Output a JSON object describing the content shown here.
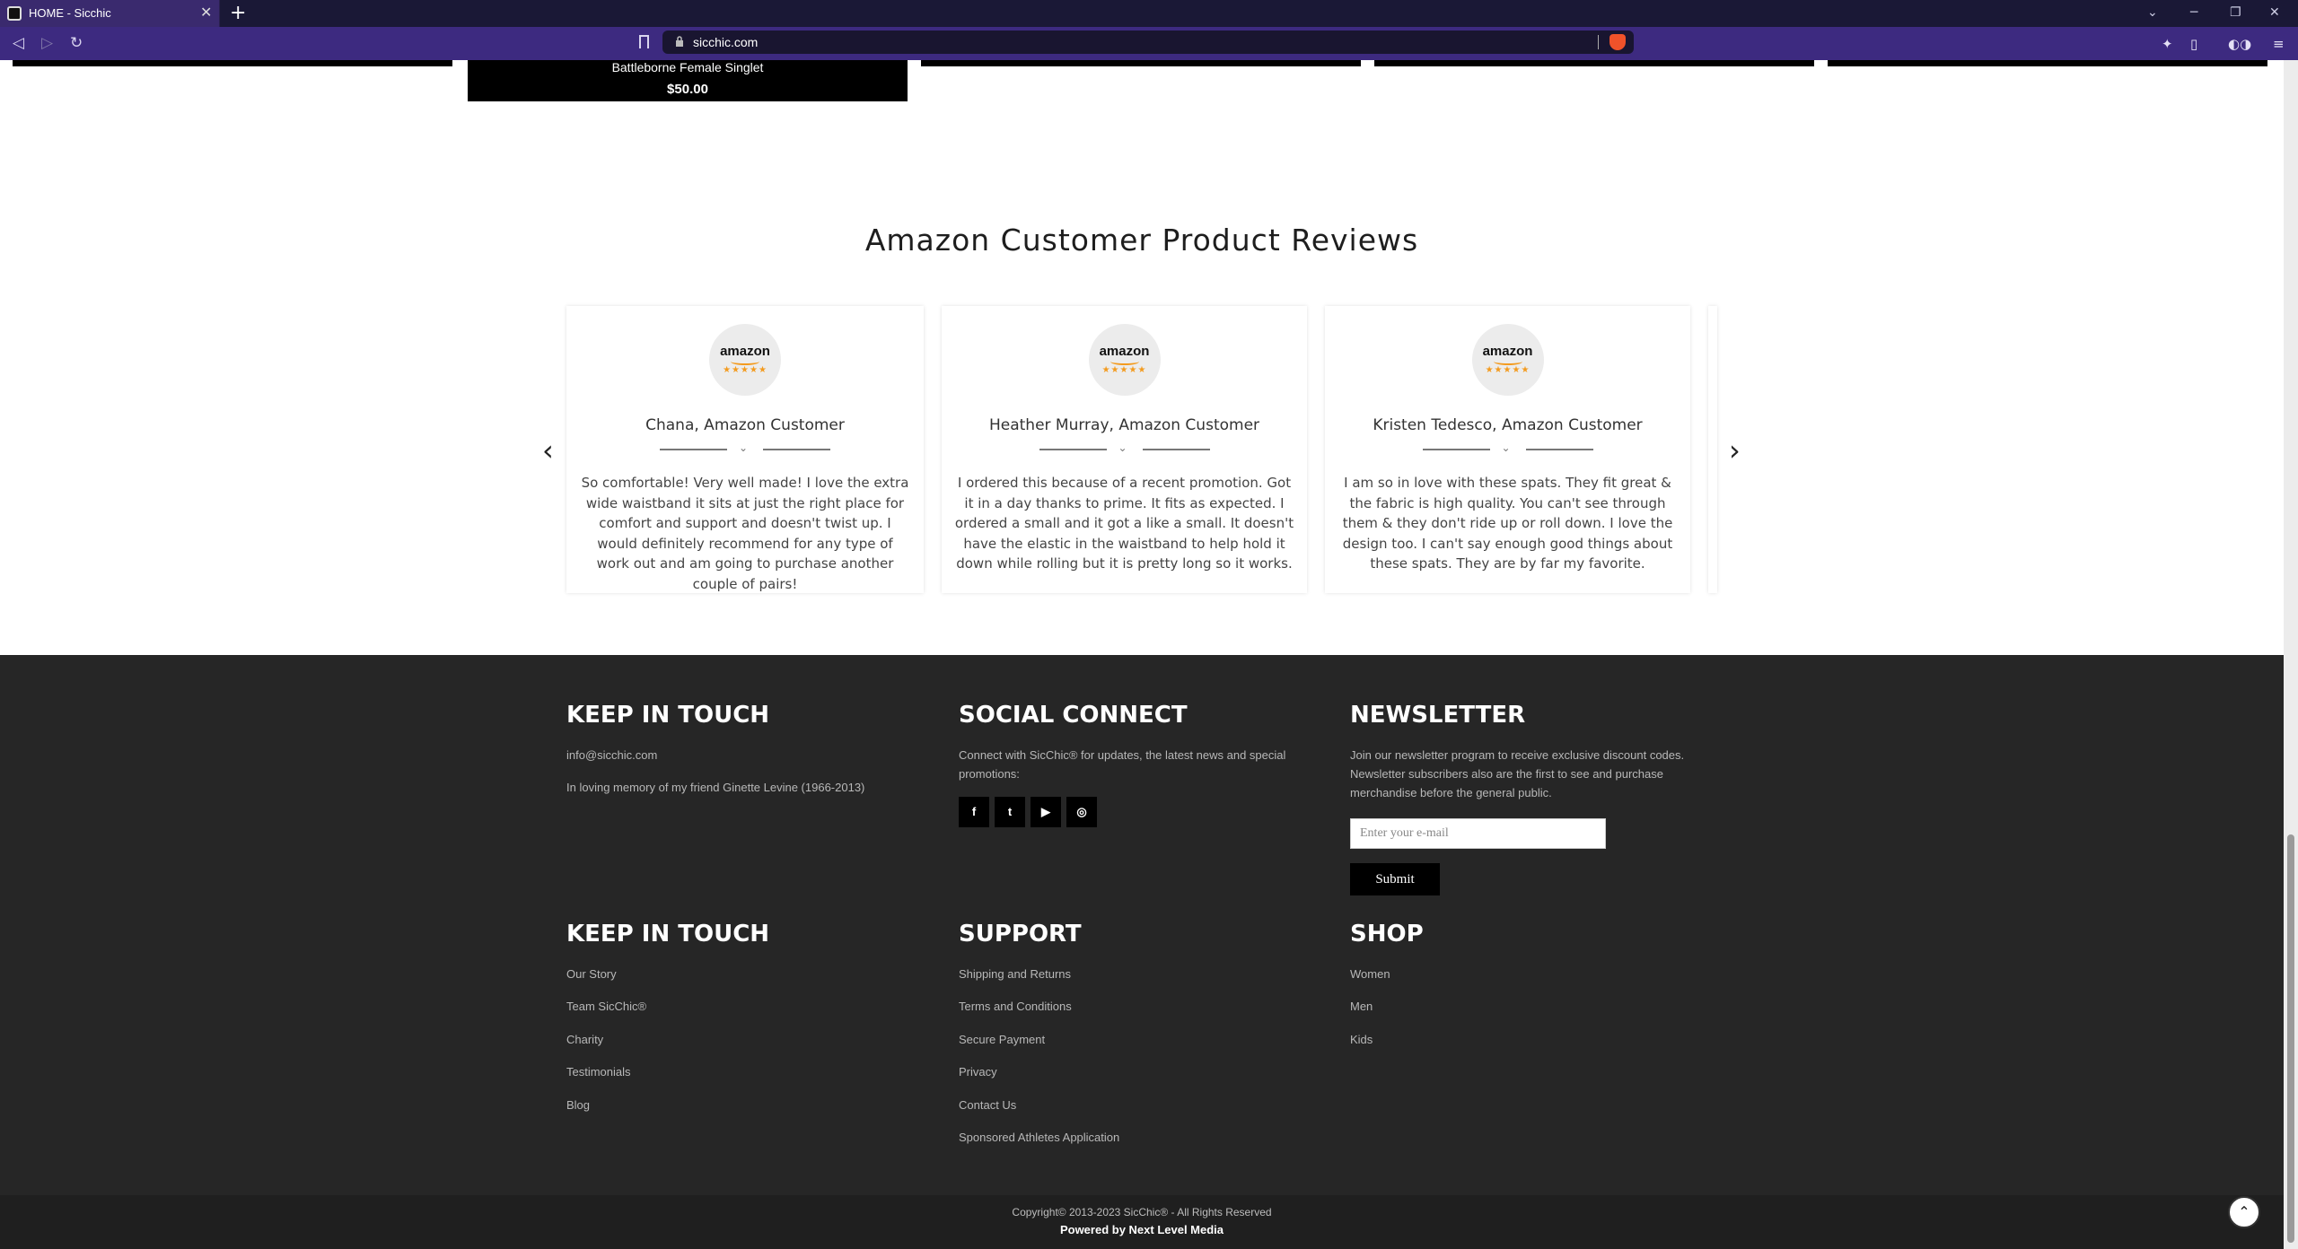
{
  "browser": {
    "tab_title": "HOME - Sicchic",
    "tab_close": "✕",
    "new_tab": "+",
    "url": "sicchic.com"
  },
  "product": {
    "name": "Battleborne Female Singlet",
    "price": "$50.00"
  },
  "reviews": {
    "title": "Amazon Customer Product Reviews",
    "logo_word": "amazon",
    "logo_stars": "★★★★★",
    "prev_arrow": "‹",
    "next_arrow": "›",
    "items": [
      {
        "name": "Chana, Amazon Customer",
        "text": "So comfortable! Very well made! I love the extra wide waistband it sits at just the right place for comfort and support and doesn't twist up. I would definitely recommend for any type of work out and am going to purchase another couple of pairs!"
      },
      {
        "name": "Heather Murray, Amazon Customer",
        "text": "I ordered this because of a recent promotion. Got it in a day thanks to prime. It fits as expected. I ordered a small and it got a like a small. It doesn't have the elastic in the waistband to help hold it down while rolling but it is pretty long so it works."
      },
      {
        "name": "Kristen Tedesco, Amazon Customer",
        "text": "I am so in love with these spats. They fit great & the fabric is high quality. You can't see through them & they don't ride up or roll down. I love the design too. I can't say enough good things about these spats. They are by far my favorite."
      }
    ]
  },
  "footer": {
    "keep_in_touch": {
      "heading": "KEEP IN TOUCH",
      "email": "info@sicchic.com",
      "memory": "In loving memory of my friend Ginette Levine (1966-2013)"
    },
    "social": {
      "heading": "SOCIAL CONNECT",
      "text": "Connect with SicChic® for updates, the latest news and special promotions:",
      "icons": [
        "f",
        "t",
        "▶",
        "◎"
      ]
    },
    "newsletter": {
      "heading": "NEWSLETTER",
      "text": "Join our newsletter program to receive exclusive discount codes. Newsletter subscribers also are the first to see and purchase merchandise before the general public.",
      "placeholder": "Enter your e-mail",
      "submit": "Submit"
    },
    "links_col1": {
      "heading": "KEEP IN TOUCH",
      "items": [
        "Our Story",
        "Team SicChic®",
        "Charity",
        "Testimonials",
        "Blog"
      ]
    },
    "support": {
      "heading": "SUPPORT",
      "items": [
        "Shipping and Returns",
        "Terms and Conditions",
        "Secure Payment",
        "Privacy",
        "Contact Us",
        "Sponsored Athletes Application"
      ]
    },
    "shop": {
      "heading": "SHOP",
      "items": [
        "Women",
        "Men",
        "Kids"
      ]
    },
    "copyright": "Copyright© 2013-2023 SicChic® - All Rights Reserved",
    "powered": "Powered by Next Level Media",
    "to_top": "⌃"
  }
}
